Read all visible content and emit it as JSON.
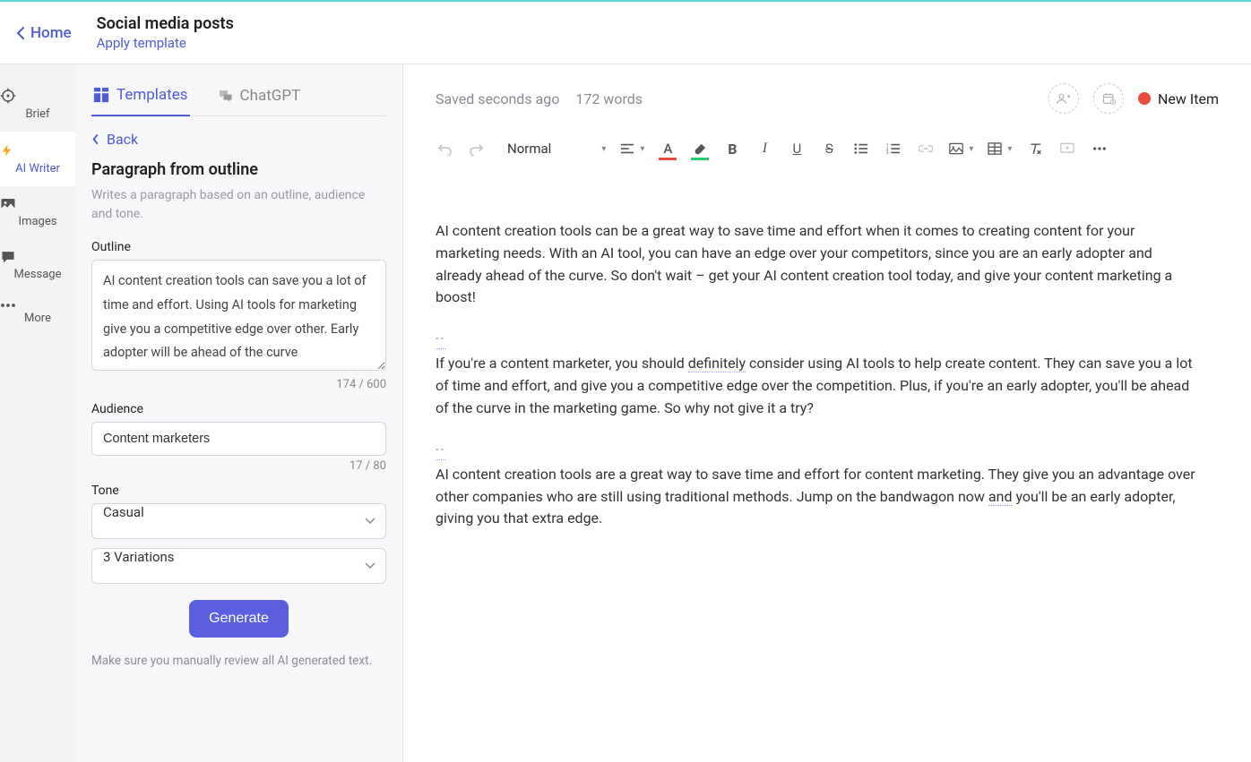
{
  "header": {
    "home_label": "Home",
    "page_title": "Social media posts",
    "apply_template": "Apply template"
  },
  "rail": {
    "items": [
      {
        "label": "Brief"
      },
      {
        "label": "AI Writer"
      },
      {
        "label": "Images"
      },
      {
        "label": "Message"
      },
      {
        "label": "More"
      }
    ]
  },
  "sidebar": {
    "tabs": {
      "templates": "Templates",
      "chatgpt": "ChatGPT"
    },
    "back": "Back",
    "panel_title": "Paragraph from outline",
    "panel_desc": "Writes a paragraph based on an outline, audience and tone.",
    "outline_label": "Outline",
    "outline_value": "AI content creation tools can save you a lot of time and effort. Using AI tools for marketing give you a competitive edge over other. Early adopter will be ahead of the curve",
    "outline_counter": "174 / 600",
    "audience_label": "Audience",
    "audience_value": "Content marketers",
    "audience_counter": "17 / 80",
    "tone_label": "Tone",
    "tone_value": "Casual",
    "variations_value": "3 Variations",
    "generate_label": "Generate",
    "review_note": "Make sure you manually review all AI generated text."
  },
  "editor": {
    "saved_status": "Saved seconds ago",
    "word_count": "172 words",
    "new_item": "New Item",
    "style_select": "Normal",
    "paragraphs": {
      "p1": "AI content creation tools can be a great way to save time and effort when it comes to creating content for your marketing needs. With an AI tool, you can have an edge over your competitors, since you are an early adopter and already ahead of the curve. So don't wait – get your AI content creation tool today, and give your content marketing a boost!",
      "p2a": "If you're a content marketer, you should ",
      "p2b": "definitely",
      "p2c": " consider using AI tools to help create content. They can save you a lot of time and effort, and give you a competitive edge over the competition. Plus, if you're an early adopter, you'll be ahead of the curve in the marketing game. So why not give it a try?",
      "p3a": "AI content creation tools are a great way to save time and effort for content marketing. They give you an advantage over other companies who are still using traditional methods. Jump on the bandwagon now ",
      "p3b": "and",
      "p3c": " you'll be an early adopter, giving you that extra edge."
    },
    "separator": "--"
  }
}
